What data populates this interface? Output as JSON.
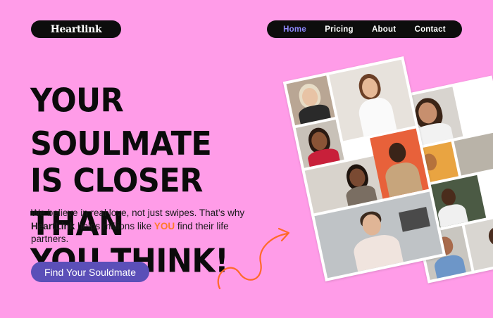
{
  "header": {
    "logo_text": "Heartlink",
    "nav": [
      {
        "label": "Home",
        "active": true
      },
      {
        "label": "Pricing",
        "active": false
      },
      {
        "label": "About",
        "active": false
      },
      {
        "label": "Contact",
        "active": false
      }
    ]
  },
  "hero": {
    "headline_lines": [
      "YOUR SOULMATE",
      "IS CLOSER THAN",
      "YOU THINK!"
    ],
    "body_part1": "We believe in real love, not just swipes. That’s why ",
    "body_brand": "HeartLink",
    "body_part2": " helps millions like ",
    "body_you": "YOU",
    "body_part3": " find their life partners.",
    "cta_label": "Find Your Souldmate"
  },
  "colors": {
    "background": "#ff9ce8",
    "pill": "#0d0d0d",
    "nav_active": "#8f88ff",
    "cta": "#5b4fb8",
    "accent": "#ff7a2a"
  },
  "icons": {
    "squiggle": "squiggle-arrow-icon"
  }
}
